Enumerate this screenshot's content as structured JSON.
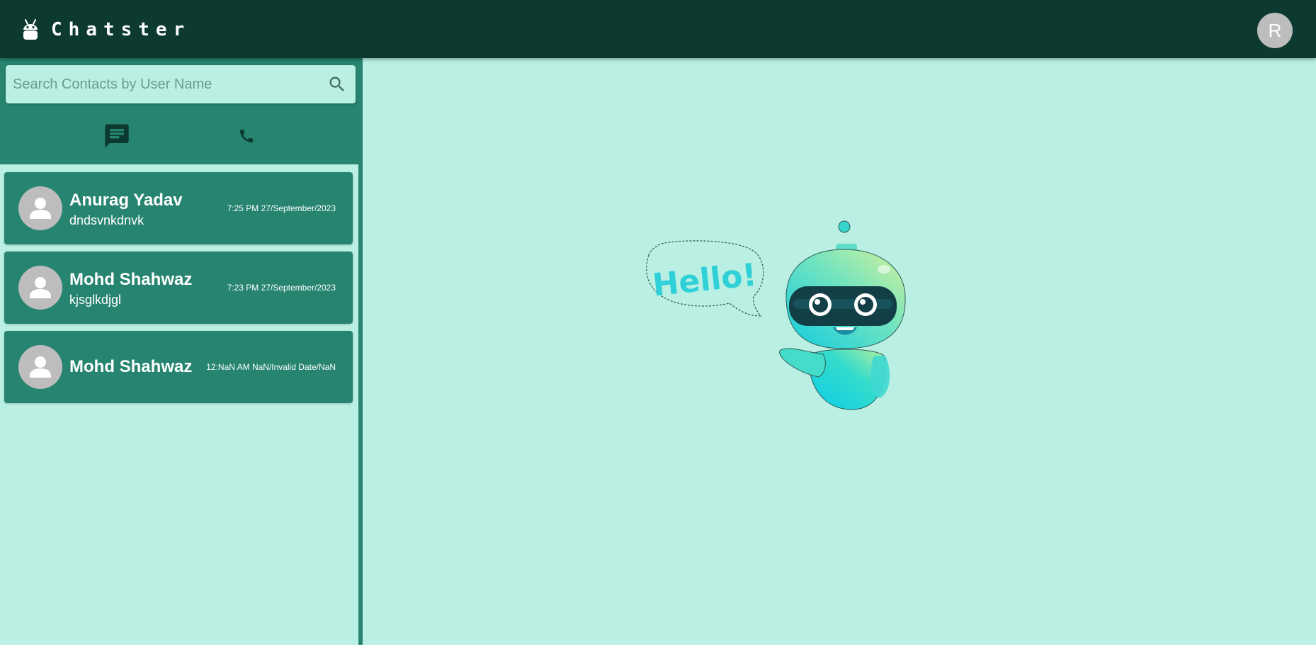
{
  "app": {
    "title": "Chatster",
    "logo_icon": "android-icon",
    "user_initial": "R"
  },
  "colors": {
    "topbar": "#0c3a30",
    "sidebar_accent": "#268470",
    "background": "#b9f0e3",
    "avatar": "#bdbdbd",
    "text_on_accent": "#ffffff"
  },
  "search": {
    "placeholder": "Search Contacts by User Name",
    "value": "",
    "icon": "search-icon"
  },
  "tabs": [
    {
      "name": "chats",
      "icon": "chat-icon",
      "active": true
    },
    {
      "name": "calls",
      "icon": "phone-icon",
      "active": false
    }
  ],
  "contacts": [
    {
      "name": "Anurag Yadav",
      "last_message": "dndsvnkdnvk",
      "time": "7:25 PM 27/September/2023"
    },
    {
      "name": "Mohd Shahwaz",
      "last_message": "kjsglkdjgl",
      "time": "7:23 PM 27/September/2023"
    },
    {
      "name": "Mohd Shahwaz",
      "last_message": "",
      "time": "12:NaN AM NaN/Invalid Date/NaN"
    }
  ],
  "welcome": {
    "speech_text": "Hello!",
    "illustration": "robot-illustration"
  }
}
